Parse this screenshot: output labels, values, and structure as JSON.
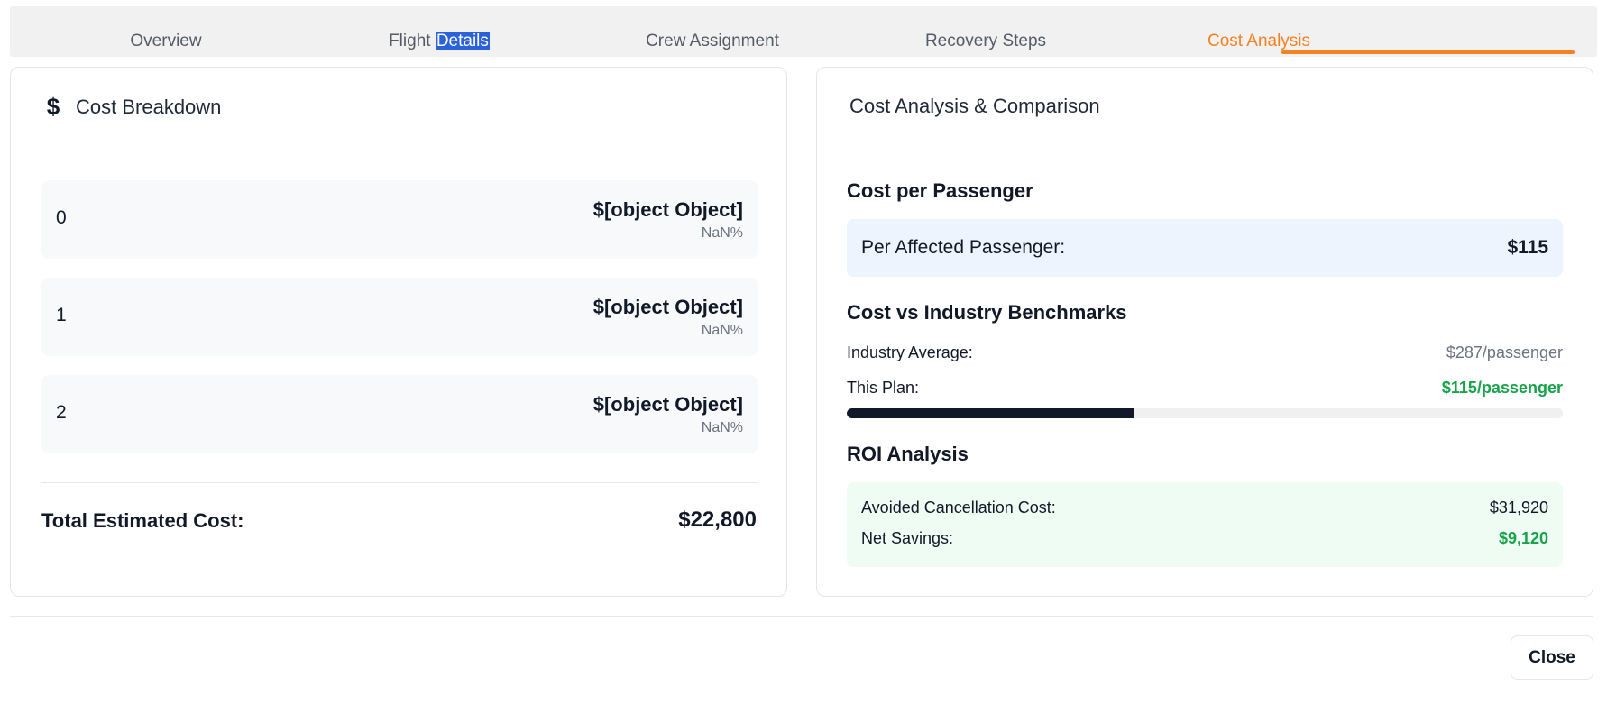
{
  "tabs": [
    {
      "label": "Overview"
    },
    {
      "label_pre": "Flight ",
      "label_sel": "Details"
    },
    {
      "label": "Crew Assignment"
    },
    {
      "label": "Recovery Steps"
    },
    {
      "label": "Cost Analysis",
      "active": true
    }
  ],
  "breakdown": {
    "title": "Cost Breakdown",
    "icon": "dollar-icon",
    "rows": [
      {
        "index": "0",
        "amount": "$[object Object]",
        "percent": "NaN%"
      },
      {
        "index": "1",
        "amount": "$[object Object]",
        "percent": "NaN%"
      },
      {
        "index": "2",
        "amount": "$[object Object]",
        "percent": "NaN%"
      }
    ],
    "total_label": "Total Estimated Cost:",
    "total_value": "$22,800"
  },
  "analysis": {
    "title": "Cost Analysis & Comparison",
    "per_passenger_heading": "Cost per Passenger",
    "per_passenger_label": "Per Affected Passenger:",
    "per_passenger_value": "$115",
    "benchmark_heading": "Cost vs Industry Benchmarks",
    "industry_label": "Industry Average:",
    "industry_value": "$287/passenger",
    "plan_label": "This Plan:",
    "plan_value": "$115/passenger",
    "plan_ratio": 0.4,
    "roi_heading": "ROI Analysis",
    "avoided_label": "Avoided Cancellation Cost:",
    "avoided_value": "$31,920",
    "savings_label": "Net Savings:",
    "savings_value": "$9,120"
  },
  "footer": {
    "close_label": "Close"
  },
  "colors": {
    "accent": "#f58220",
    "positive": "#16a34a",
    "selection": "#2b62d9"
  }
}
